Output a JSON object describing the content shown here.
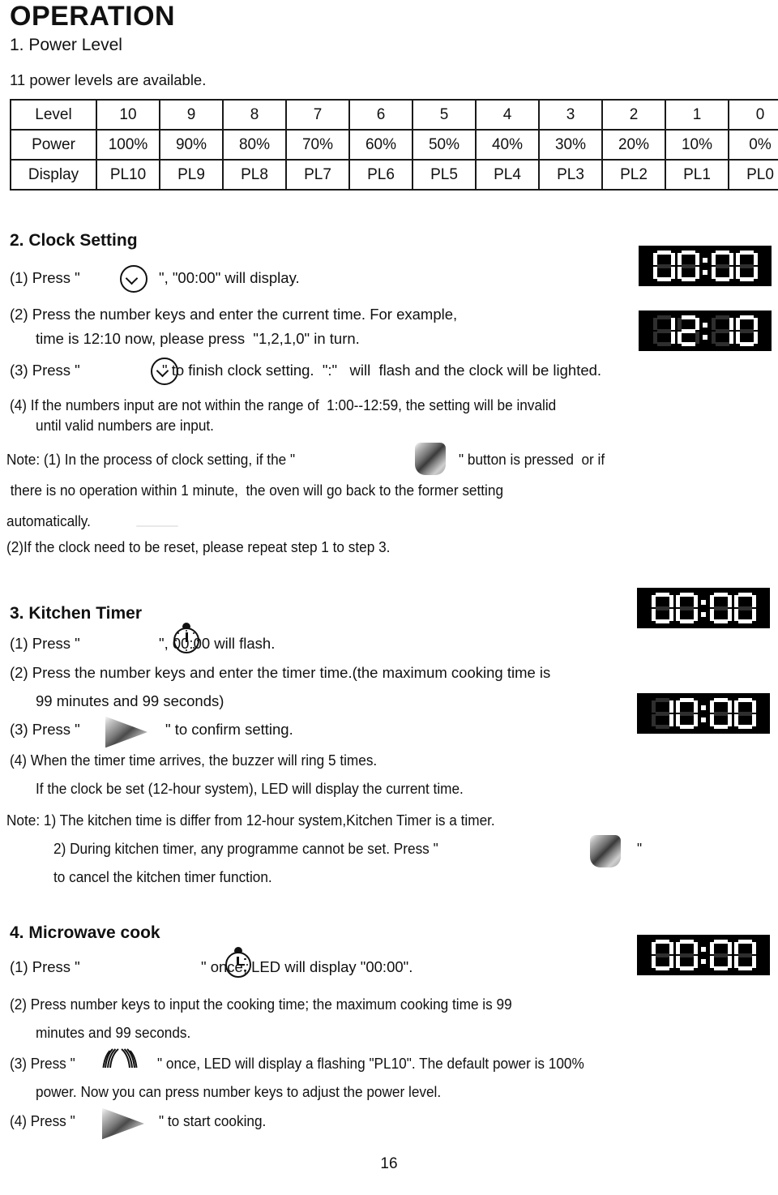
{
  "page": {
    "title": "OPERATION",
    "number": "16"
  },
  "section1": {
    "heading": "1. Power Level",
    "intro": "11 power levels are available.",
    "table": {
      "row_labels": [
        "Level",
        "Power",
        "Display"
      ],
      "levels": [
        "10",
        "9",
        "8",
        "7",
        "6",
        "5",
        "4",
        "3",
        "2",
        "1",
        "0"
      ],
      "powers": [
        "100%",
        "90%",
        "80%",
        "70%",
        "60%",
        "50%",
        "40%",
        "30%",
        "20%",
        "10%",
        "0%"
      ],
      "displays": [
        "PL10",
        "PL9",
        "PL8",
        "PL7",
        "PL6",
        "PL5",
        "PL4",
        "PL3",
        "PL2",
        "PL1",
        "PL0"
      ]
    }
  },
  "section2": {
    "heading": "2. Clock Setting",
    "l1_pre": "(1) Press \"",
    "l1_post": "\", \"00:00\" will display.",
    "l2a": "(2) Press the number keys and enter the current time. For example,",
    "l2b": "time is 12:10 now, please press  \"1,2,1,0\" in turn.",
    "l3_pre": "(3) Press \"",
    "l3_post": "\" to finish clock setting.  \":\"   will  flash and the clock will be lighted.",
    "l4a": "(4) If the numbers input are not within the range of  1:00--12:59, the setting will be invalid",
    "l4b": "until valid numbers are input.",
    "note1_pre": "Note: (1) In the process of clock setting, if the \"",
    "note1_post": "\" button is pressed  or if",
    "note2": " there is no operation within 1 minute,  the oven will go back to the former setting",
    "note3": "automatically.",
    "note4": "(2)If the clock need to be reset, please repeat step 1 to step 3.",
    "led_top": "00:00",
    "led_bottom": "12:10"
  },
  "section3": {
    "heading": "3. Kitchen Timer",
    "l1_pre": "(1) Press \"",
    "l1_post": "\", 00:00 will flash.",
    "l2a": "(2) Press the number keys and enter the timer time.(the maximum cooking time is",
    "l2b": "99 minutes and 99 seconds)",
    "l3_pre": "(3) Press \"",
    "l3_post": "\" to confirm setting.",
    "l4a": "(4) When the timer time arrives, the buzzer will ring 5 times.",
    "l4b": "If the clock be set (12-hour system), LED will display the current time.",
    "note1": "Note: 1) The kitchen time is differ from 12-hour system,Kitchen Timer is a timer.",
    "note2_pre": "2) During kitchen timer, any programme cannot be set. Press \"",
    "note2_post": "\"",
    "note3": "to cancel the kitchen timer function.",
    "led_top": "00:00",
    "led_bottom": "10:00"
  },
  "section4": {
    "heading": "4. Microwave cook",
    "l1_pre": "(1) Press \"",
    "l1_post": "\" once, LED will display \"00:00\".",
    "l2a": "(2) Press number keys to input the cooking time; the maximum cooking time is 99",
    "l2b": "minutes and 99 seconds.",
    "l3_pre": "(3) Press \"",
    "l3_post": "\" once, LED will display a flashing \"PL10\". The default power is 100%",
    "l3b": "power. Now you can press number keys to adjust the power level.",
    "l4_pre": "(4) Press \"",
    "l4_post": "\" to start cooking.",
    "led": "00:00"
  },
  "icons": {
    "clock": "clock-icon",
    "stopwatch": "stopwatch-icon",
    "microwave_clock": "microwave-clock-icon",
    "waves": "microwave-waves-icon",
    "stop_button": "stop-cancel-button-icon",
    "start_button": "start-play-button-icon"
  },
  "colors": {
    "text": "#111111",
    "led_background": "#000000",
    "led_segment_on": "#ffffff",
    "led_segment_off": "#2e2e2e",
    "table_border": "#1a1a1a"
  }
}
